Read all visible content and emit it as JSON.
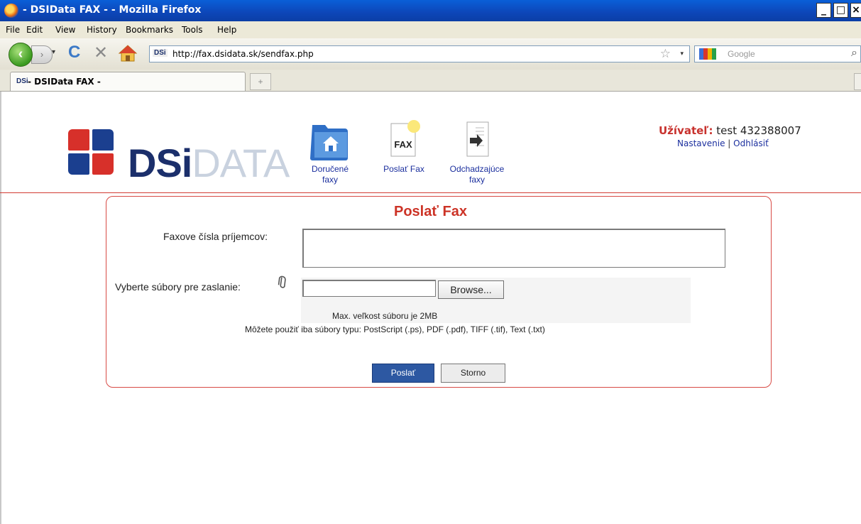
{
  "window": {
    "title": " - DSIData FAX - - Mozilla Firefox",
    "minimize_glyph": "_",
    "maximize_glyph": "□",
    "close_glyph": "×"
  },
  "menu": {
    "items": [
      "File",
      "Edit",
      "View",
      "History",
      "Bookmarks",
      "Tools",
      "Help"
    ]
  },
  "toolbar": {
    "url": "http://fax.dsidata.sk/sendfax.php",
    "url_favicon": "DSi",
    "search_placeholder": "Google",
    "back_glyph": "‹",
    "forward_glyph": "›",
    "dropdown_glyph": "▾",
    "reload_glyph": "C",
    "stop_glyph": "✕",
    "star_glyph": "☆",
    "search_glyph": "⌕"
  },
  "tabs": {
    "active_label": " - DSIData FAX - ",
    "active_favicon": "DSi",
    "new_tab_glyph": "+"
  },
  "site": {
    "logo_text_1": "DSi",
    "logo_text_2": "DATA",
    "nav": [
      {
        "label_1": "Doručené",
        "label_2": "faxy"
      },
      {
        "label_1": "Poslať Fax",
        "label_2": ""
      },
      {
        "label_1": "Odchadzajúce",
        "label_2": "faxy"
      }
    ],
    "fax_icon_text": "FAX",
    "user_label": "Užívateľ:",
    "user_value": "test 432388007",
    "settings_link": "Nastavenie",
    "separator": "|",
    "logout_link": "Odhlásiť"
  },
  "form": {
    "title": "Poslať Fax",
    "recipients_label": "Faxove čísla príjemcov:",
    "recipients_value": "",
    "files_label": "Vyberte súbory pre zaslanie:",
    "clip_glyph": "⌀",
    "file_value": "",
    "browse_label": "Browse...",
    "max_size_text": "Max. veľkost súboru je 2MB",
    "types_text": "Môžete použiť iba súbory typu: PostScript (.ps), PDF (.pdf), TIFF (.tif), Text (.txt)",
    "send_label": "Poslať",
    "cancel_label": "Storno"
  },
  "colors": {
    "accent_red": "#cc3326",
    "primary_blue": "#2d58a2",
    "link_blue": "#1b2f9e",
    "logo_navy": "#1b2f6b",
    "logo_light": "#c9d2df"
  }
}
